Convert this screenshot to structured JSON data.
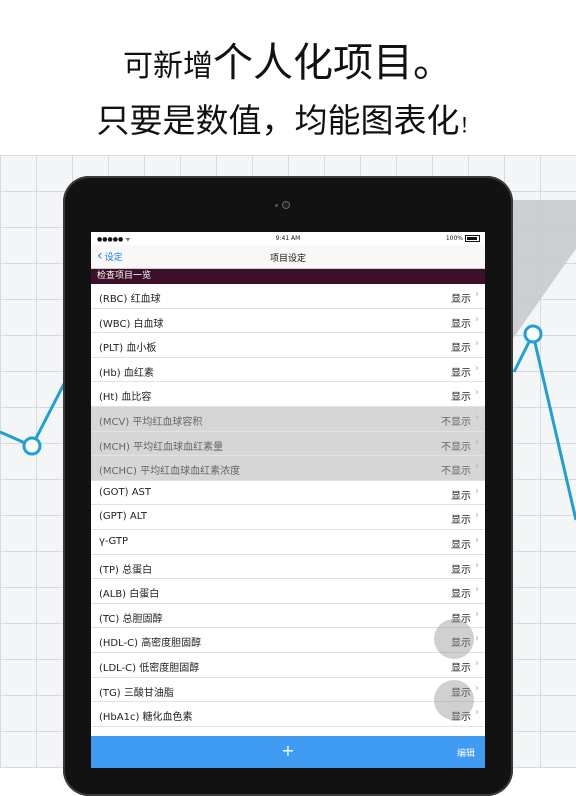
{
  "headline": {
    "line1_prefix": "可新增",
    "line1_emphasis": "个人化项目。",
    "line2_main": "只要是数值，均能图表化",
    "line2_end": "！"
  },
  "status_bar": {
    "signal": "●●●●● ᯤ",
    "time": "9:41 AM",
    "battery": "100%"
  },
  "nav": {
    "back_label": "设定",
    "title": "项目设定"
  },
  "section": {
    "title": "检查项目一览"
  },
  "items": [
    {
      "label": "(RBC) 红血球",
      "value": "显示",
      "on": true
    },
    {
      "label": "(WBC) 白血球",
      "value": "显示",
      "on": true
    },
    {
      "label": "(PLT) 血小板",
      "value": "显示",
      "on": true
    },
    {
      "label": "(Hb) 血红素",
      "value": "显示",
      "on": true
    },
    {
      "label": "(Ht) 血比容",
      "value": "显示",
      "on": true
    },
    {
      "label": "(MCV) 平均红血球容积",
      "value": "不显示",
      "on": false
    },
    {
      "label": "(MCH) 平均红血球血红素量",
      "value": "不显示",
      "on": false
    },
    {
      "label": "(MCHC) 平均红血球血红素浓度",
      "value": "不显示",
      "on": false
    },
    {
      "label": "(GOT) AST",
      "value": "显示",
      "on": true
    },
    {
      "label": "(GPT) ALT",
      "value": "显示",
      "on": true
    },
    {
      "label": "γ-GTP",
      "value": "显示",
      "on": true
    },
    {
      "label": "(TP) 总蛋白",
      "value": "显示",
      "on": true
    },
    {
      "label": "(ALB) 白蛋白",
      "value": "显示",
      "on": true
    },
    {
      "label": "(TC) 总胆固醇",
      "value": "显示",
      "on": true
    },
    {
      "label": "(HDL-C) 高密度胆固醇",
      "value": "显示",
      "on": true
    },
    {
      "label": "(LDL-C) 低密度胆固醇",
      "value": "显示",
      "on": true
    },
    {
      "label": "(TG) 三酸甘油脂",
      "value": "显示",
      "on": true
    },
    {
      "label": "(HbA1c) 糖化血色素",
      "value": "显示",
      "on": true
    }
  ],
  "toolbar": {
    "add_label": "+",
    "edit_label": "编辑"
  },
  "colors": {
    "section_bg": "#3b1028",
    "accent": "#1a7cf0",
    "toolbar_bg": "#3f9cf2",
    "chart_line": "#1ea0d6"
  },
  "icons": {
    "back": "chevron-left-icon",
    "row_disclosure": "chevron-right-icon",
    "add": "plus-icon"
  }
}
